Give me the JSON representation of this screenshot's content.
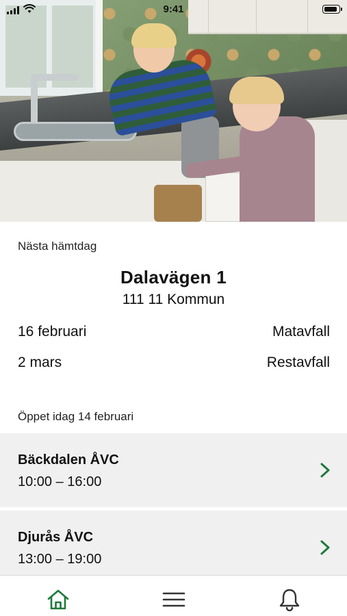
{
  "status_bar": {
    "time": "9:41",
    "battery_level": 0.9
  },
  "hero": {
    "image": "kids-sorting-waste-in-kitchen-photo"
  },
  "next_pickup": {
    "label": "Nästa hämtdag",
    "address": "Dalavägen 1",
    "postal": "111 11 Kommun",
    "items": [
      {
        "date": "16 februari",
        "type": "Matavfall"
      },
      {
        "date": "2 mars",
        "type": "Restavfall"
      }
    ]
  },
  "open_today": {
    "label": "Öppet idag 14 februari",
    "stations": [
      {
        "name": "Bäckdalen ÅVC",
        "hours": "10:00 – 16:00"
      },
      {
        "name": "Djurås ÅVC",
        "hours": "13:00 – 19:00"
      }
    ]
  },
  "tab_bar": {
    "items": [
      {
        "icon": "home-icon",
        "active": true
      },
      {
        "icon": "menu-icon",
        "active": false
      },
      {
        "icon": "bell-icon",
        "active": false
      }
    ]
  },
  "colors": {
    "accent": "#1e7a3a",
    "row_bg": "#f0f0f0",
    "text": "#111111"
  }
}
